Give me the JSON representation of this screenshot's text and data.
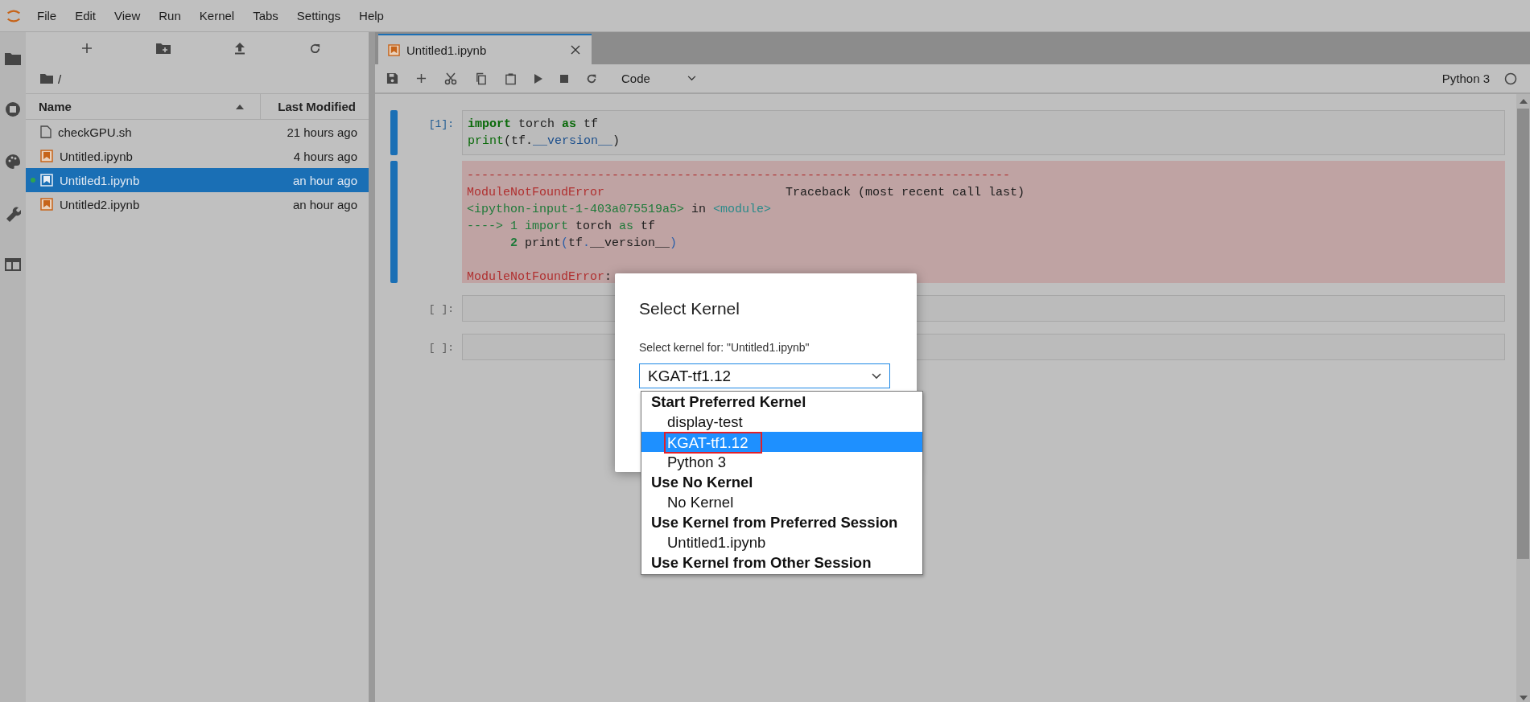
{
  "menu_bar": {
    "items": [
      "File",
      "Edit",
      "View",
      "Run",
      "Kernel",
      "Tabs",
      "Settings",
      "Help"
    ]
  },
  "file_browser": {
    "breadcrumb": "/",
    "columns": [
      "Name",
      "Last Modified"
    ],
    "rows": [
      {
        "name": "checkGPU.sh",
        "modified": "21 hours ago",
        "kind": "file",
        "selected": false,
        "running": false
      },
      {
        "name": "Untitled.ipynb",
        "modified": "4 hours ago",
        "kind": "notebook",
        "selected": false,
        "running": false
      },
      {
        "name": "Untitled1.ipynb",
        "modified": "an hour ago",
        "kind": "notebook",
        "selected": true,
        "running": true
      },
      {
        "name": "Untitled2.ipynb",
        "modified": "an hour ago",
        "kind": "notebook",
        "selected": false,
        "running": false
      }
    ]
  },
  "notebook": {
    "tab": {
      "title": "Untitled1.ipynb"
    },
    "toolbar": {
      "cell_type": "Code",
      "kernel": "Python 3"
    },
    "cells": [
      {
        "prompt": "[1]:",
        "selected": true,
        "input": [
          {
            "tokens": [
              {
                "text": "import",
                "kind": "kw"
              },
              {
                "text": " torch ",
                "kind": "plain"
              },
              {
                "text": "as",
                "kind": "kw"
              },
              {
                "text": " tf",
                "kind": "plain"
              }
            ]
          },
          {
            "tokens": [
              {
                "text": "print",
                "kind": "builtin"
              },
              {
                "text": "(tf.",
                "kind": "plain"
              },
              {
                "text": "__version__",
                "kind": "attr"
              },
              {
                "text": ")",
                "kind": "plain"
              }
            ]
          }
        ],
        "output": [
          {
            "tokens": [
              {
                "text": "---------------------------------------------------------------------------",
                "kind": "err"
              }
            ]
          },
          {
            "tokens": [
              {
                "text": "ModuleNotFoundError",
                "kind": "err"
              },
              {
                "text": "                         Traceback (most recent call last)",
                "kind": "plain"
              }
            ]
          },
          {
            "tokens": [
              {
                "text": "<ipython-input-1-403a075519a5>",
                "kind": "green"
              },
              {
                "text": " in ",
                "kind": "plain"
              },
              {
                "text": "<module>",
                "kind": "cyan"
              }
            ]
          },
          {
            "tokens": [
              {
                "text": "----> 1 ",
                "kind": "green"
              },
              {
                "text": "import",
                "kind": "green"
              },
              {
                "text": " torch ",
                "kind": "plain"
              },
              {
                "text": "as",
                "kind": "green"
              },
              {
                "text": " tf",
                "kind": "plain"
              }
            ]
          },
          {
            "indent": true,
            "tokens": [
              {
                "text": "2",
                "kind": "greenbold"
              },
              {
                "text": " print",
                "kind": "plain"
              },
              {
                "text": "(",
                "kind": "blue"
              },
              {
                "text": "tf",
                "kind": "plain"
              },
              {
                "text": ".",
                "kind": "blue"
              },
              {
                "text": "__version__",
                "kind": "plain"
              },
              {
                "text": ")",
                "kind": "blue"
              }
            ]
          },
          {
            "gap_before": true,
            "tokens": [
              {
                "text": "ModuleNotFoundError",
                "kind": "err"
              },
              {
                "text": ":",
                "kind": "plain"
              }
            ]
          }
        ]
      },
      {
        "prompt": "[ ]:",
        "selected": false
      },
      {
        "prompt": "[ ]:",
        "selected": false
      }
    ]
  },
  "dialog": {
    "title": "Select Kernel",
    "label": "Select kernel for: \"Untitled1.ipynb\"",
    "value": "KGAT-tf1.12",
    "options": [
      {
        "kind": "group",
        "label": "Start Preferred Kernel"
      },
      {
        "kind": "option",
        "label": "display-test",
        "selected": false,
        "annotated": false
      },
      {
        "kind": "option",
        "label": "KGAT-tf1.12",
        "selected": true,
        "annotated": true
      },
      {
        "kind": "option",
        "label": "Python 3",
        "selected": false,
        "annotated": false
      },
      {
        "kind": "group",
        "label": "Use No Kernel"
      },
      {
        "kind": "option",
        "label": "No Kernel",
        "selected": false,
        "annotated": false
      },
      {
        "kind": "group",
        "label": "Use Kernel from Preferred Session"
      },
      {
        "kind": "option",
        "label": "Untitled1.ipynb",
        "selected": false,
        "annotated": false
      },
      {
        "kind": "group",
        "label": "Use Kernel from Other Session"
      }
    ]
  }
}
